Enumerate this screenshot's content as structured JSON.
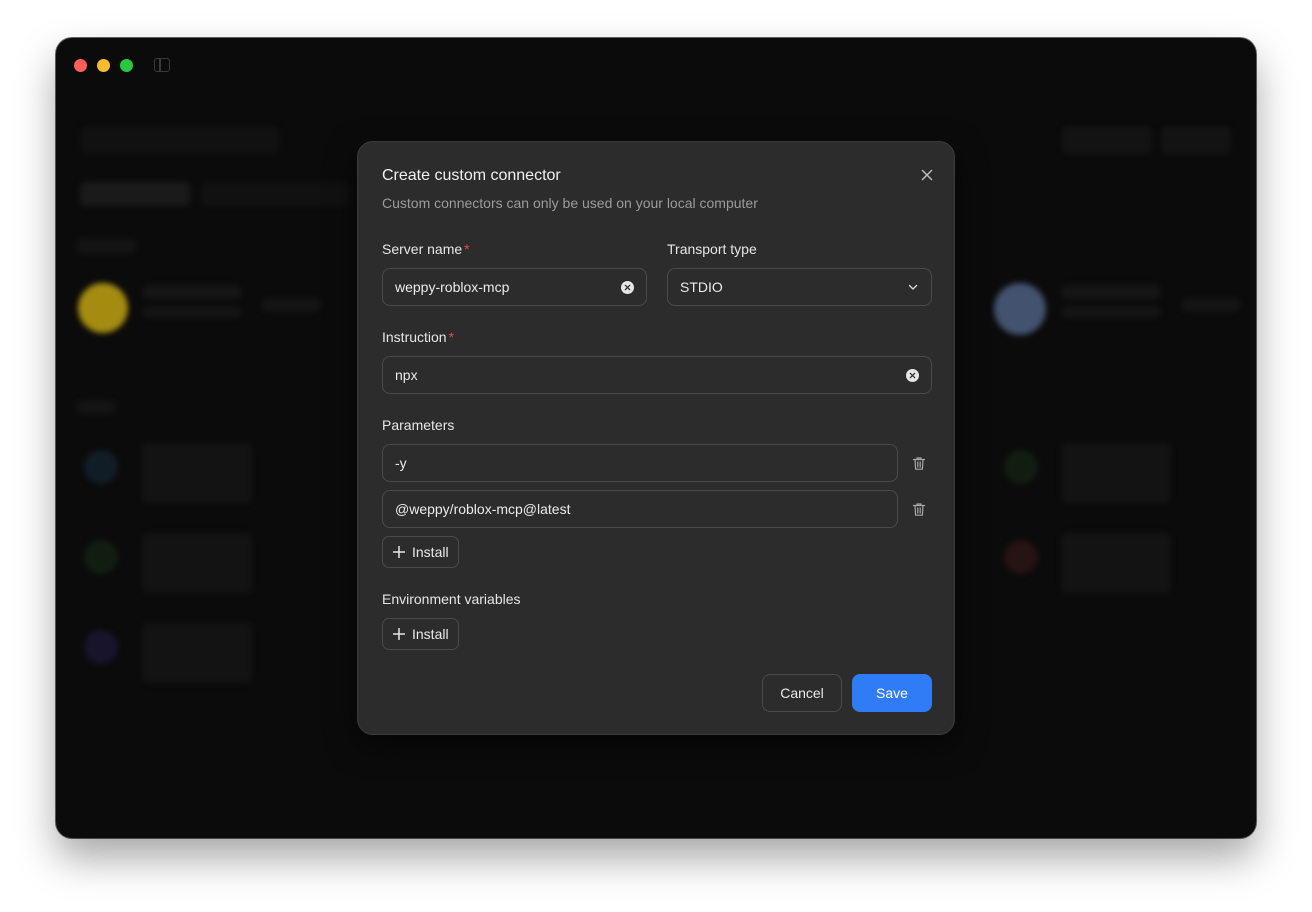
{
  "modal": {
    "title": "Create custom connector",
    "subtitle": "Custom connectors can only be used on your local computer",
    "server_name": {
      "label": "Server name",
      "required_mark": "*",
      "value": "weppy-roblox-mcp"
    },
    "transport_type": {
      "label": "Transport type",
      "value": "STDIO"
    },
    "instruction": {
      "label": "Instruction",
      "required_mark": "*",
      "value": "npx"
    },
    "parameters": {
      "label": "Parameters",
      "items": [
        "-y",
        "@weppy/roblox-mcp@latest"
      ],
      "add_label": "Install"
    },
    "env_vars": {
      "label": "Environment variables",
      "add_label": "Install"
    },
    "cancel_label": "Cancel",
    "save_label": "Save"
  },
  "colors": {
    "accent": "#2f7cf6",
    "required": "#e5484d",
    "modal_bg": "#2c2c2c"
  }
}
